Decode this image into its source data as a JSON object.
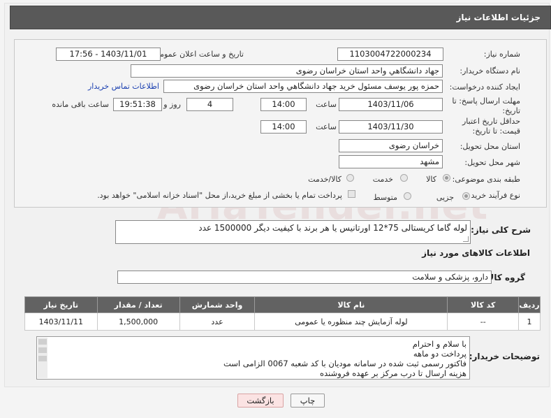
{
  "header": {
    "title": "جزئیات اطلاعات نیاز"
  },
  "fields": {
    "need_number": {
      "label": "شماره نیاز:",
      "value": "1103004722000234"
    },
    "announce_datetime": {
      "label": "تاریخ و ساعت اعلان عمومی:",
      "value": "1403/11/01 - 17:56"
    },
    "buyer_org": {
      "label": "نام دستگاه خریدار:",
      "value": "جهاد دانشگاهي واحد استان خراسان رضوی"
    },
    "requester": {
      "label": "ایجاد کننده درخواست:",
      "value": "حمزه  پور یوسف مسئول خرید جهاد دانشگاهي واحد استان خراسان رضوی"
    },
    "buyer_contact_link": "اطلاعات تماس خریدار",
    "deadline": {
      "label": "مهلت ارسال پاسخ: تا تاریخ:",
      "date": "1403/11/06",
      "time_label": "ساعت",
      "time": "14:00",
      "days": "4",
      "days_label": "روز و",
      "remaining": "19:51:38",
      "remaining_label": "ساعت باقی مانده"
    },
    "price_validity": {
      "label": "حداقل تاریخ اعتبار قیمت: تا تاریخ:",
      "date": "1403/11/30",
      "time_label": "ساعت",
      "time": "14:00"
    },
    "delivery_province": {
      "label": "استان محل تحویل:",
      "value": "خراسان رضوی"
    },
    "delivery_city": {
      "label": "شهر محل تحویل:",
      "value": "مشهد"
    },
    "category": {
      "label": "طبقه بندی موضوعی:",
      "options": [
        "کالا",
        "خدمت",
        "کالا/خدمت"
      ],
      "selected": "کالا"
    },
    "purchase_type": {
      "label": "نوع فرآیند خرید :",
      "options": [
        "جزیی",
        "متوسط"
      ],
      "selected": "جزیی",
      "payment_note": "پرداخت تمام یا بخشی از مبلغ خرید،از محل \"اسناد خزانه اسلامی\" خواهد بود."
    }
  },
  "description": {
    "label": "شرح کلی نیاز:",
    "value": "لوله گاما کریستالی 75*12 اورتانیس یا هر برند با کیفیت دیگر 1500000 عدد"
  },
  "goods_info": {
    "title": "اطلاعات کالاهای مورد نیاز",
    "group_label": "گروه کالا:",
    "group_value": "دارو، پزشکی و سلامت"
  },
  "table": {
    "headers": [
      "ردیف",
      "کد کالا",
      "نام کالا",
      "واحد شمارش",
      "تعداد / مقدار",
      "تاریخ نیاز"
    ],
    "rows": [
      {
        "row": "1",
        "code": "--",
        "name": "لوله آزمایش چند منظوره یا عمومی",
        "unit": "عدد",
        "qty": "1,500,000",
        "date": "1403/11/11"
      }
    ]
  },
  "buyer_notes": {
    "label": "توضیحات خریدار:",
    "lines": [
      "با سلام و احترام",
      "پرداخت دو ماهه",
      "فاکتور رسمی ثبت شده در سامانه مودیان با کد شعبه 0067 الزامی است",
      "هزینه ارسال تا درب مرکز بر عهده فروشنده"
    ]
  },
  "buttons": {
    "print": "چاپ",
    "back": "بازگشت"
  },
  "watermark": "AriaTender.net",
  "colors": {
    "header_bg": "#595959",
    "table_header_bg": "#626262",
    "link": "#1a3fb0",
    "back_button_bg": "#fbe3e3"
  }
}
